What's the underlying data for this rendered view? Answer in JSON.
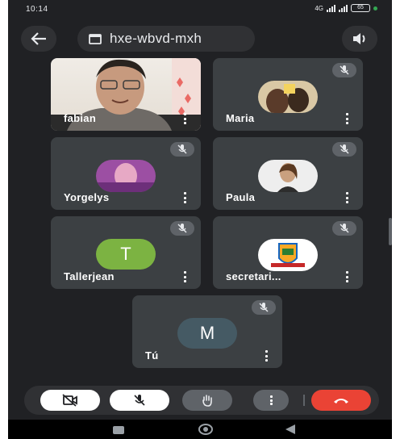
{
  "status_bar": {
    "time": "10:14",
    "network_label": "4G",
    "battery": "65"
  },
  "meeting": {
    "code": "hxe-wbvd-mxh"
  },
  "participants": [
    {
      "name": "fabian",
      "kind": "video",
      "muted": false
    },
    {
      "name": "Maria",
      "kind": "photo",
      "muted": true
    },
    {
      "name": "Yorgelys",
      "kind": "photo",
      "muted": true
    },
    {
      "name": "Paula",
      "kind": "photo",
      "muted": true
    },
    {
      "name": "Tallerjean",
      "kind": "letter",
      "letter": "T",
      "avatar_color": "#7cb342",
      "muted": true
    },
    {
      "name": "secretari...",
      "kind": "logo",
      "muted": true
    },
    {
      "name": "Tú",
      "kind": "letter",
      "letter": "M",
      "avatar_color": "#455a64",
      "muted": true
    }
  ],
  "controls": {
    "camera": "camera-off-icon",
    "mic": "mic-off-icon",
    "hand": "raise-hand-icon",
    "more": "more-vert-icon",
    "end_call": "end-call-icon",
    "end_call_color": "#ea4335"
  },
  "colors": {
    "background": "#202124",
    "tile": "#3c4043",
    "accent_green": "#34a853"
  }
}
